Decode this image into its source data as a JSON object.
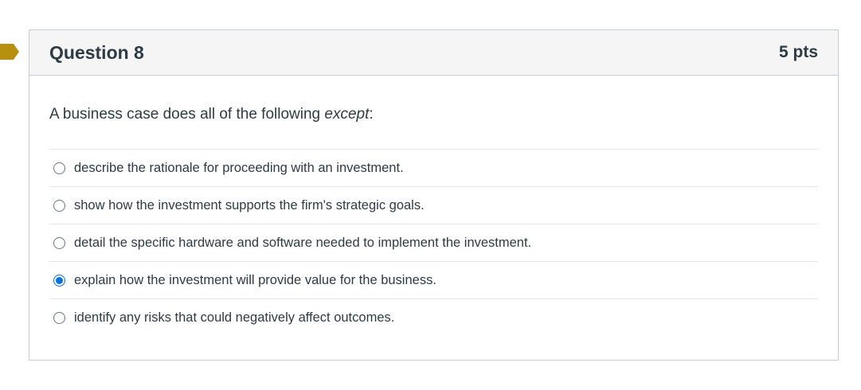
{
  "question": {
    "title": "Question 8",
    "points": "5 pts",
    "text_before": "A business case does all of the following ",
    "text_emphasis": "except",
    "text_after": ":"
  },
  "answers": [
    {
      "label": "describe the rationale for proceeding with an investment.",
      "selected": false
    },
    {
      "label": "show how the investment supports the firm's strategic goals.",
      "selected": false
    },
    {
      "label": "detail the specific hardware and software needed to implement the investment.",
      "selected": false
    },
    {
      "label": "explain how the investment will provide value for the business.",
      "selected": true
    },
    {
      "label": "identify any risks that could negatively affect outcomes.",
      "selected": false
    }
  ],
  "colors": {
    "flag": "#b8900f",
    "radio_selected": "#0770e3",
    "header_bg": "#f5f5f5",
    "text": "#2d3b45"
  }
}
